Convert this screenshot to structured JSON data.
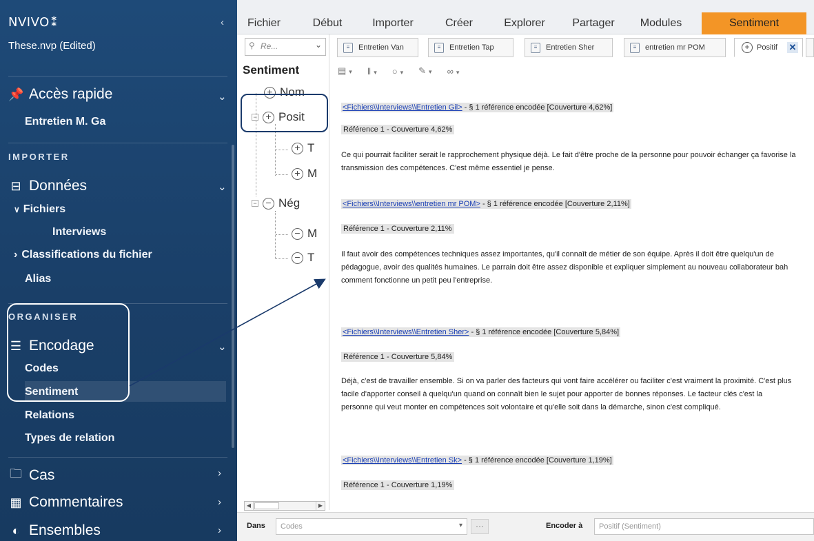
{
  "sidebar": {
    "logo": "NVIVO",
    "logo_mark": "⁑",
    "collapse": "‹",
    "project": "These.nvp (Edited)",
    "quick_access": {
      "label": "Accès rapide",
      "icon": "pin-icon",
      "item": "Entretien M. Ga"
    },
    "sections": {
      "importer": "IMPORTER",
      "organiser": "ORGANISER"
    },
    "donnees": {
      "label": "Données",
      "icon": "grid-icon"
    },
    "fichiers": "Fichiers",
    "interviews": "Interviews",
    "classifications": "Classifications du fichier",
    "alias": "Alias",
    "encodage": {
      "label": "Encodage",
      "icon": "lines-icon"
    },
    "encodage_items": [
      "Codes",
      "Sentiment",
      "Relations",
      "Types de relation"
    ],
    "cas": {
      "label": "Cas",
      "icon": "briefcase-icon"
    },
    "commentaires": {
      "label": "Commentaires",
      "icon": "notebook-icon"
    },
    "ensembles": {
      "label": "Ensembles",
      "icon": "sets-icon"
    },
    "active_item": "Sentiment"
  },
  "ribbon": {
    "tabs": [
      "Fichier",
      "Début",
      "Importer",
      "Créer",
      "Explorer",
      "Partager",
      "Modules",
      "Sentiment"
    ],
    "active_tab": "Sentiment",
    "accent_color": "#f39526"
  },
  "nav": {
    "search_placeholder": "Re...",
    "title": "Sentiment",
    "nodes": {
      "nom": "Nom",
      "positif": "Posit",
      "t1": "T",
      "m1": "M",
      "negatif": "Nég",
      "m2": "M",
      "t2": "T"
    }
  },
  "doc_tabs": [
    "Entretien Van",
    "Entretien Tap",
    "Entretien Sher",
    "entretien mr POM",
    "Positif"
  ],
  "toolbar": {
    "items": [
      "▤",
      "‖",
      "○",
      "✎",
      "∞"
    ]
  },
  "content": {
    "refs": [
      {
        "link": "<Fichiers\\\\Interviews\\\\Entretien Gil>",
        "summary": " - § 1 référence encodée  [Couverture 4,62%]",
        "sub": "Référence 1 - Couverture 4,62%",
        "text": "Ce qui pourrait faciliter serait le rapprochement physique déjà. Le fait d'être proche de la personne pour pouvoir échanger ça favorise la transmission des compétences. C'est même essentiel je pense."
      },
      {
        "link": "<Fichiers\\\\Interviews\\\\entretien mr POM>",
        "summary": " - § 1 référence encodée  [Couverture 2,11%]",
        "sub": "Référence 1 - Couverture 2,11%",
        "text": "Il faut avoir des compétences techniques assez importantes, qu'il connaît de métier de son équipe. Après il doit être quelqu'un de pédagogue, avoir des qualités humaines. Le parrain doit être assez disponible et expliquer simplement au nouveau collaborateur bah comment fonctionne un petit peu l'entreprise."
      },
      {
        "link": "<Fichiers\\\\Interviews\\\\Entretien Sher>",
        "summary": " - § 1 référence encodée  [Couverture 5,84%]",
        "sub": "Référence 1 - Couverture 5,84%",
        "text": "Déjà, c'est de travailler ensemble. Si on va parler des facteurs qui vont faire accélérer ou faciliter c'est vraiment la proximité. C'est plus facile d'apporter conseil à quelqu'un quand on connaît bien le sujet pour apporter de bonnes réponses. Le facteur clés c'est la personne qui veut monter en compétences soit volontaire et qu'elle soit dans la démarche, sinon c'est compliqué."
      },
      {
        "link": "<Fichiers\\\\Interviews\\\\Entretien Sk>",
        "summary": " - § 1 référence encodée  [Couverture 1,19%]",
        "sub": "Référence 1 - Couverture 1,19%",
        "text": ""
      }
    ]
  },
  "bottom": {
    "in_label": "Dans",
    "in_value": "Codes",
    "dots": "···",
    "encode_label": "Encoder à",
    "encode_value": "Positif (Sentiment)"
  }
}
